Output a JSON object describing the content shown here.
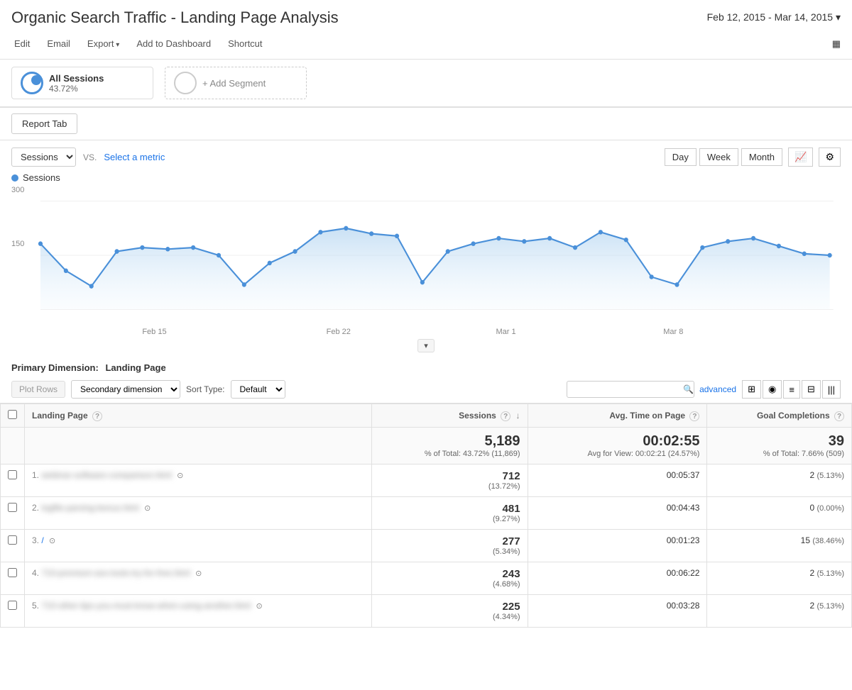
{
  "header": {
    "title": "Organic Search Traffic - Landing Page Analysis",
    "date_range": "Feb 12, 2015 - Mar 14, 2015"
  },
  "toolbar": {
    "edit": "Edit",
    "email": "Email",
    "export": "Export",
    "add_to_dashboard": "Add to Dashboard",
    "shortcut": "Shortcut"
  },
  "segments": {
    "all_sessions_label": "All Sessions",
    "all_sessions_pct": "43.72%",
    "add_segment_label": "+ Add Segment"
  },
  "report_tab": {
    "label": "Report Tab"
  },
  "chart": {
    "metric_label": "Sessions",
    "vs_label": "VS.",
    "select_metric": "Select a metric",
    "day_btn": "Day",
    "week_btn": "Week",
    "month_btn": "Month",
    "sessions_legend": "Sessions",
    "y_axis_300": "300",
    "y_axis_150": "150",
    "x_labels": [
      "Feb 15",
      "Feb 22",
      "Mar 1",
      "Mar 8"
    ]
  },
  "primary_dimension": {
    "label": "Primary Dimension:",
    "value": "Landing Page"
  },
  "table_controls": {
    "plot_rows": "Plot Rows",
    "secondary_dimension": "Secondary dimension",
    "sort_type_label": "Sort Type:",
    "sort_type_value": "Default",
    "search_placeholder": "",
    "advanced": "advanced"
  },
  "table": {
    "columns": [
      {
        "key": "landing_page",
        "label": "Landing Page"
      },
      {
        "key": "sessions",
        "label": "Sessions"
      },
      {
        "key": "avg_time",
        "label": "Avg. Time on Page"
      },
      {
        "key": "goal_completions",
        "label": "Goal Completions"
      }
    ],
    "totals": {
      "sessions": "5,189",
      "sessions_sub": "% of Total: 43.72% (11,869)",
      "avg_time": "00:02:55",
      "avg_time_sub": "Avg for View: 00:02:21 (24.57%)",
      "goal_completions": "39",
      "goal_completions_sub": "% of Total: 7.66% (509)"
    },
    "rows": [
      {
        "num": "1.",
        "page": "webinar-software-comparison.html",
        "sessions": "712",
        "sessions_pct": "(13.72%)",
        "avg_time": "00:05:37",
        "goals": "2",
        "goals_pct": "(5.13%)"
      },
      {
        "num": "2.",
        "page": "logfile-parsing-bonus.html",
        "sessions": "481",
        "sessions_pct": "(9.27%)",
        "avg_time": "00:04:43",
        "goals": "0",
        "goals_pct": "(0.00%)"
      },
      {
        "num": "3.",
        "page": "/",
        "sessions": "277",
        "sessions_pct": "(5.34%)",
        "avg_time": "00:01:23",
        "goals": "15",
        "goals_pct": "(38.46%)"
      },
      {
        "num": "4.",
        "page": "710-premium-seo-tools-try-for-free.html",
        "sessions": "243",
        "sessions_pct": "(4.68%)",
        "avg_time": "00:06:22",
        "goals": "2",
        "goals_pct": "(5.13%)"
      },
      {
        "num": "5.",
        "page": "710-other-tips-you-must-know-when-using-another.html",
        "sessions": "225",
        "sessions_pct": "(4.34%)",
        "avg_time": "00:03:28",
        "goals": "2",
        "goals_pct": "(5.13%)"
      }
    ]
  },
  "icons": {
    "dropdown_arrow": "▾",
    "sort_down": "↓",
    "search": "🔍",
    "qr_code": "▦",
    "grid_view": "⊞",
    "pie_view": "◉",
    "list_view": "≡",
    "filter_view": "⊟",
    "bar_view": "|||"
  }
}
